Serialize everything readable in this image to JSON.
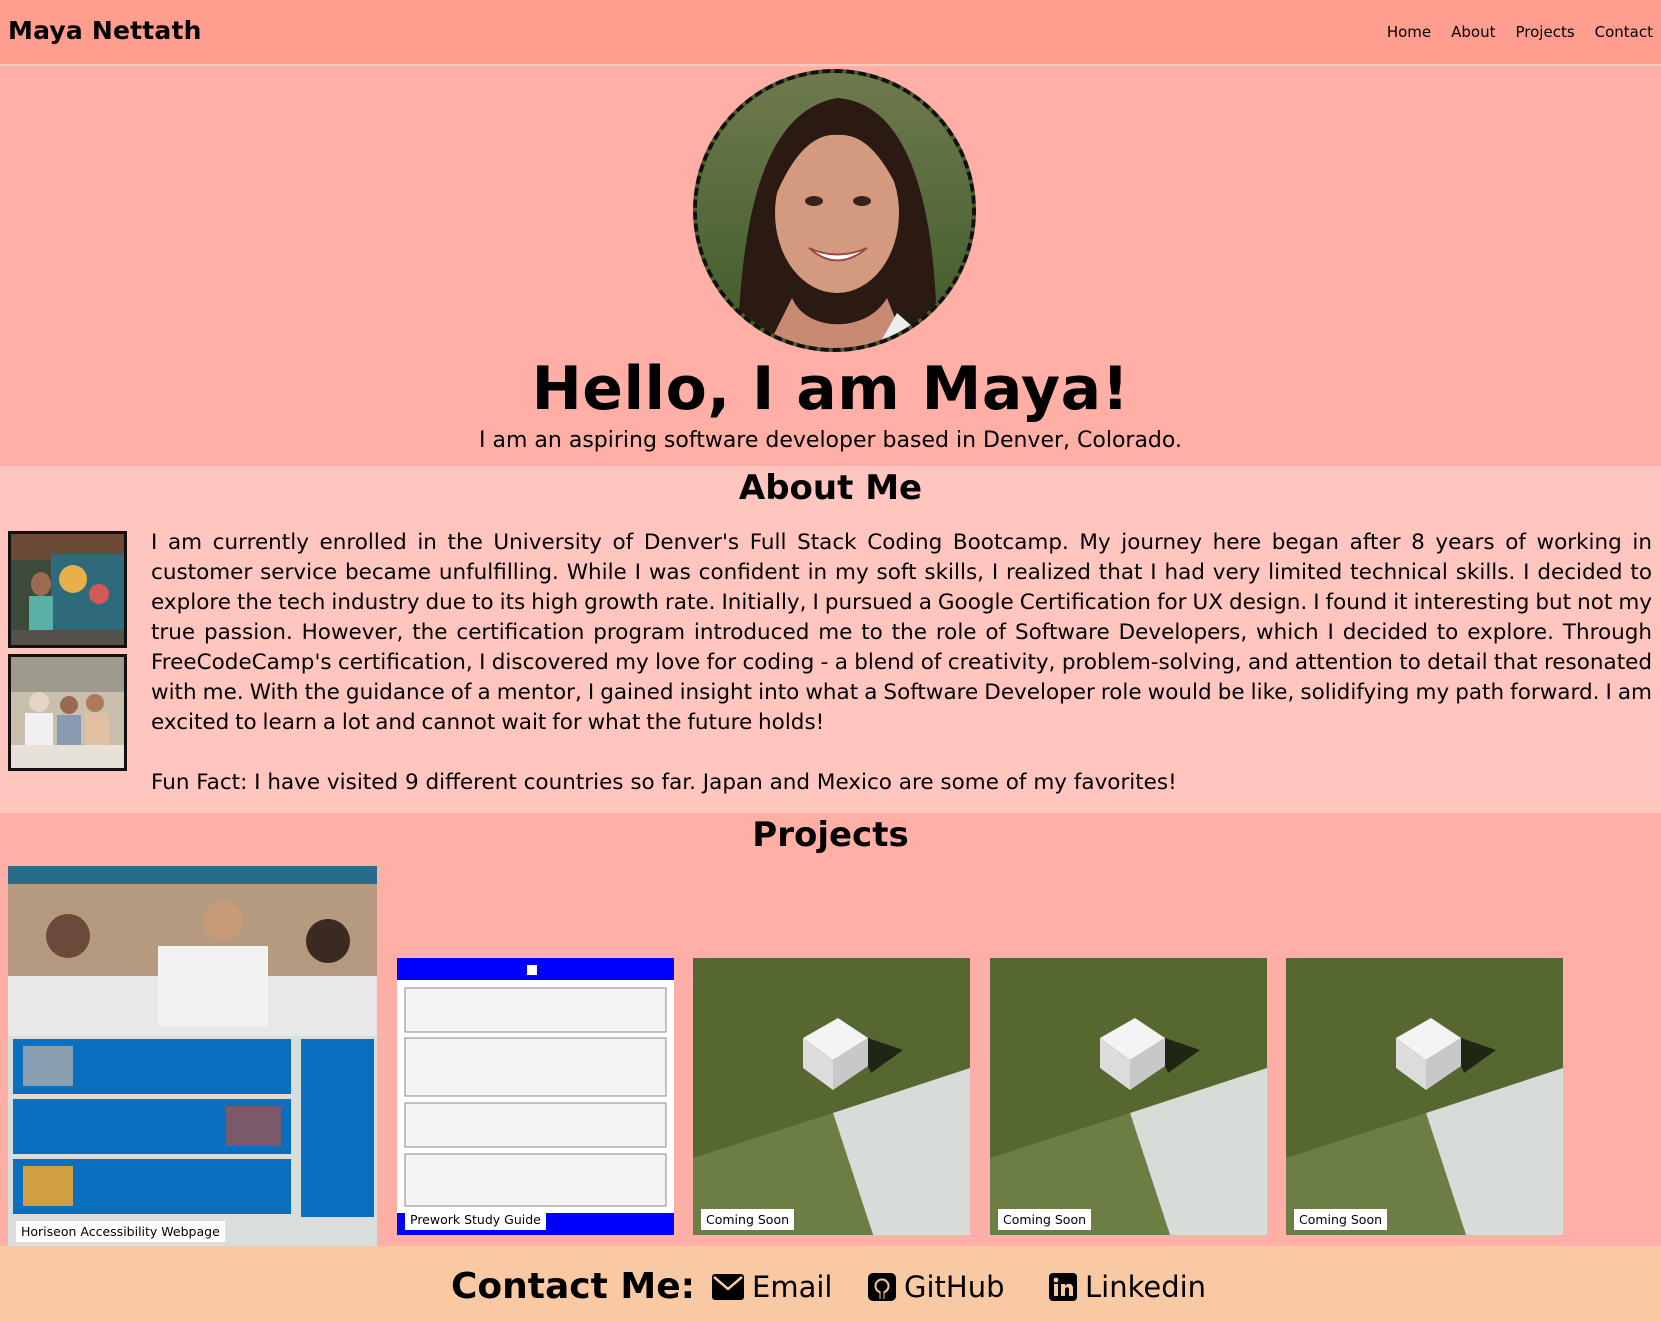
{
  "header": {
    "brand": "Maya Nettath",
    "nav": [
      {
        "label": "Home"
      },
      {
        "label": "About"
      },
      {
        "label": "Projects"
      },
      {
        "label": "Contact"
      }
    ]
  },
  "hero": {
    "avatar_icon": "profile-photo",
    "title": "Hello, I am Maya!",
    "subtitle": "I am an aspiring software developer based in Denver, Colorado."
  },
  "about": {
    "title": "About Me",
    "body": "I am currently enrolled in the University of Denver's Full Stack Coding Bootcamp. My journey here began after 8 years of working in customer service became unfulfilling. While I was confident in my soft skills, I realized that I had very limited technical skills. I decided to explore the tech industry due to its high growth rate. Initially, I pursued a Google Certification for UX design. I found it interesting but not my true passion. However, the certification program introduced me to the role of Software Developers, which I decided to explore. Through FreeCodeCamp's certification, I discovered my love for coding - a blend of creativity, problem-solving, and attention to detail that resonated with me. With the guidance of a mentor, I gained insight into what a Software Developer role would be like, solidifying my path forward. I am excited to learn a lot and cannot wait for what the future holds!",
    "fun_fact": "Fun Fact: I have visited 9 different countries so far. Japan and Mexico are some of my favorites!"
  },
  "projects": {
    "title": "Projects",
    "items": [
      {
        "label": "Horiseon Accessibility Webpage"
      },
      {
        "label": "Prework Study Guide"
      },
      {
        "label": "Coming Soon"
      },
      {
        "label": "Coming Soon"
      },
      {
        "label": "Coming Soon"
      }
    ]
  },
  "contact": {
    "title": "Contact Me:",
    "links": [
      {
        "label": "Email",
        "icon": "envelope-icon"
      },
      {
        "label": "GitHub",
        "icon": "github-icon"
      },
      {
        "label": "Linkedin",
        "icon": "linkedin-icon"
      }
    ]
  },
  "colors": {
    "header_bg": "#ff9d8f",
    "hero_bg": "#ffafa5",
    "about_bg": "#ffc5be",
    "contact_bg": "#f8c9a3"
  }
}
